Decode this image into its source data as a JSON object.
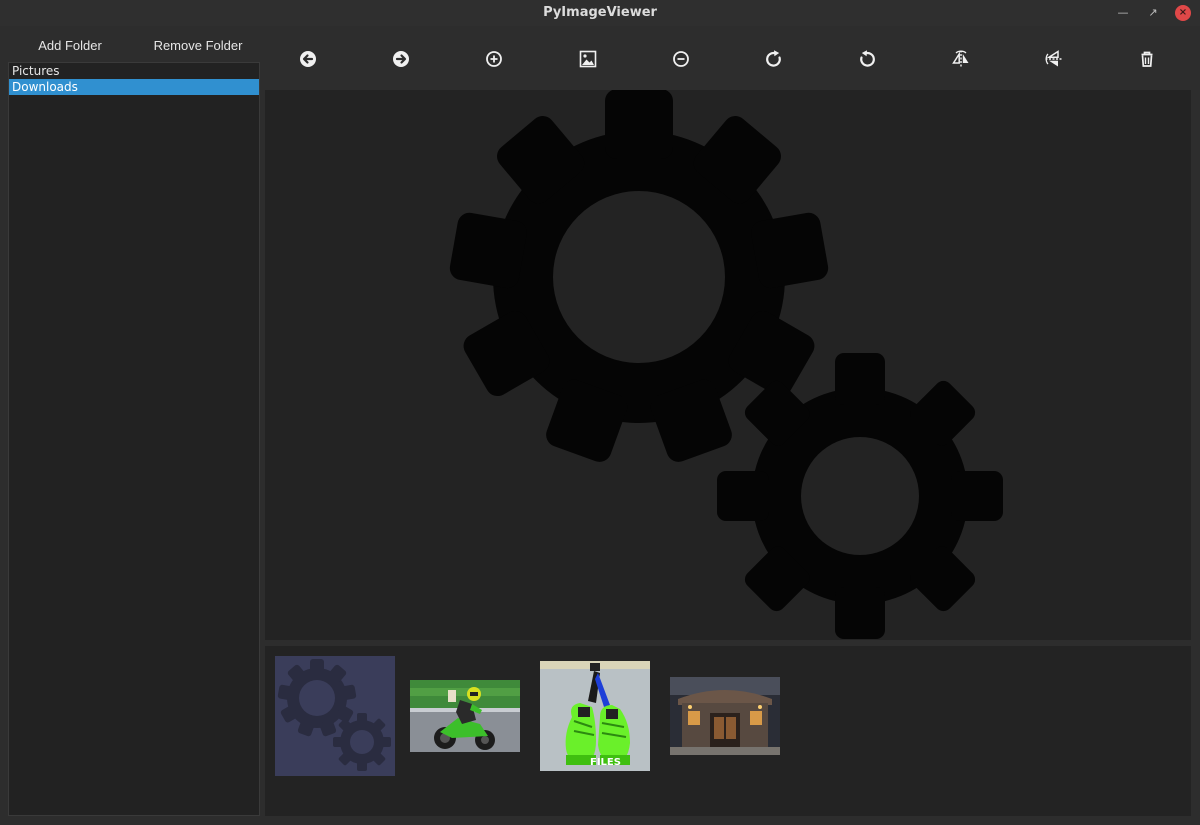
{
  "window": {
    "title": "PyImageViewer",
    "controls": [
      "minimize",
      "maximize",
      "close"
    ]
  },
  "folder_panel": {
    "add_label": "Add Folder",
    "remove_label": "Remove Folder",
    "folders": [
      {
        "label": "Pictures",
        "selected": false
      },
      {
        "label": "Downloads",
        "selected": true
      }
    ]
  },
  "toolbar": {
    "icons": [
      "arrow-left-icon",
      "arrow-right-icon",
      "zoom-in-icon",
      "fit-image-icon",
      "zoom-out-icon",
      "rotate-clockwise-icon",
      "rotate-counterclockwise-icon",
      "flip-horizontal-icon",
      "flip-vertical-icon",
      "trash-icon"
    ]
  },
  "viewer": {
    "image": "gears-icon",
    "background": "#232323",
    "fill": "#050505"
  },
  "thumbnails": [
    {
      "name": "gears",
      "selected": true
    },
    {
      "name": "motorcycle-rider",
      "selected": false
    },
    {
      "name": "green-sneakers",
      "selected": false,
      "caption": "FILES"
    },
    {
      "name": "building-entrance",
      "selected": false
    }
  ],
  "colors": {
    "selection": "#3090d0",
    "close": "#e04848",
    "thumb_selected_bg": "#3a3d5a"
  }
}
